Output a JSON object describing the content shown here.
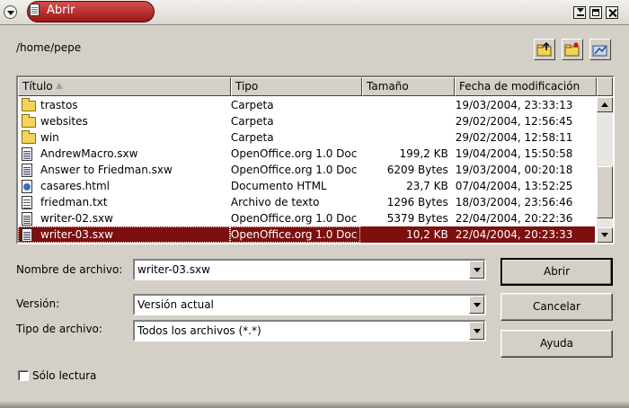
{
  "window": {
    "title": "Abrir"
  },
  "path": "/home/pepe",
  "toolbar": {
    "up_icon": "folder-up-icon",
    "new_folder_icon": "new-folder-icon",
    "default_dir_icon": "default-directory-icon"
  },
  "columns": {
    "name": "Título",
    "type": "Tipo",
    "size": "Tamaño",
    "date": "Fecha de modificación"
  },
  "files": [
    {
      "icon": "folder",
      "name": "trastos",
      "type": "Carpeta",
      "size": "",
      "date": "19/03/2004, 23:33:13"
    },
    {
      "icon": "folder",
      "name": "websites",
      "type": "Carpeta",
      "size": "",
      "date": "29/02/2004, 12:56:45"
    },
    {
      "icon": "folder",
      "name": "win",
      "type": "Carpeta",
      "size": "",
      "date": "29/02/2004, 12:58:11"
    },
    {
      "icon": "doc",
      "name": "AndrewMacro.sxw",
      "type": "OpenOffice.org 1.0 Doc",
      "size": "199,2 KB",
      "date": "19/04/2004, 15:50:58"
    },
    {
      "icon": "doc",
      "name": "Answer to Friedman.sxw",
      "type": "OpenOffice.org 1.0 Doc",
      "size": "6209 Bytes",
      "date": "19/03/2004, 00:20:18"
    },
    {
      "icon": "html",
      "name": "casares.html",
      "type": "Documento HTML",
      "size": "23,7 KB",
      "date": "07/04/2004, 13:52:25"
    },
    {
      "icon": "txt",
      "name": "friedman.txt",
      "type": "Archivo de texto",
      "size": "1296 Bytes",
      "date": "18/03/2004, 23:56:46"
    },
    {
      "icon": "doc",
      "name": "writer-02.sxw",
      "type": "OpenOffice.org 1.0 Doc",
      "size": "5379 Bytes",
      "date": "22/04/2004, 20:22:36"
    },
    {
      "icon": "doc",
      "name": "writer-03.sxw",
      "type": "OpenOffice.org 1.0 Doc",
      "size": "10,2 KB",
      "date": "22/04/2004, 20:23:33",
      "selected": true
    }
  ],
  "scroll": {
    "position": 0.85,
    "visible_fraction": 0.45
  },
  "form": {
    "filename_label": "Nombre de archivo:",
    "filename_value": "writer-03.sxw",
    "version_label": "Versión:",
    "version_value": "Versión actual",
    "filetype_label": "Tipo de archivo:",
    "filetype_value": "Todos los archivos (*.*)",
    "readonly_label": "Sólo lectura",
    "readonly_checked": false
  },
  "buttons": {
    "open": "Abrir",
    "cancel": "Cancelar",
    "help": "Ayuda"
  },
  "colors": {
    "selection": "#7d0f0f",
    "title_accent": "#b02020",
    "dialog_bg": "#d4d0c8"
  }
}
